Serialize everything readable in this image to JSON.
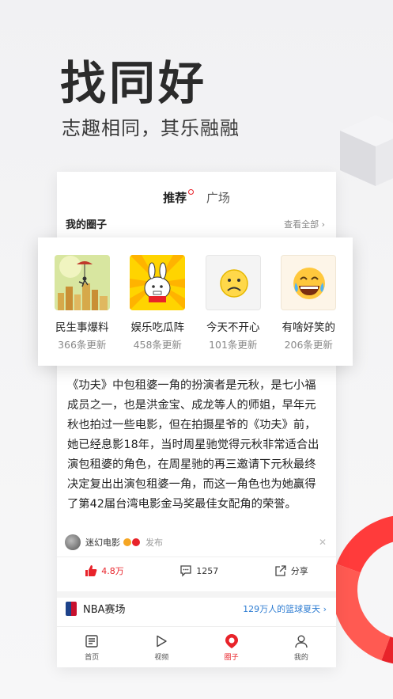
{
  "promo": {
    "headline": "找同好",
    "subhead": "志趣相同，其乐融融"
  },
  "tabs": [
    {
      "label": "推荐",
      "active": true
    },
    {
      "label": "广场",
      "active": false
    }
  ],
  "my_circles": {
    "title": "我的圈子",
    "see_all": "查看全部",
    "items": [
      {
        "name": "民生事爆料",
        "count": "366条更新"
      },
      {
        "name": "娱乐吃瓜阵",
        "count": "458条更新"
      },
      {
        "name": "今天不开心",
        "count": "101条更新"
      },
      {
        "name": "有啥好笑的",
        "count": "206条更新"
      }
    ]
  },
  "post": {
    "text": "《功夫》中包租婆一角的扮演者是元秋，是七小福成员之一，也是洪金宝、成龙等人的师姐，早年元秋也拍过一些电影，但在拍摄星爷的《功夫》前，她已经息影18年，当时周星驰觉得元秋非常适合出演包租婆的角色，在周星驰的再三邀请下元秋最终决定复出出演包租婆一角，而这一角色也为她赢得了第42届台湾电影金马奖最佳女配角的荣誉。",
    "author": "迷幻电影",
    "publish_label": "发布",
    "likes": "4.8万",
    "comments": "1257",
    "share_label": "分享"
  },
  "nba": {
    "name": "NBA赛场",
    "promo": "129万人的篮球夏天"
  },
  "bottom_nav": [
    {
      "label": "首页",
      "icon": "news-icon"
    },
    {
      "label": "视频",
      "icon": "play-icon"
    },
    {
      "label": "圈子",
      "icon": "circle-pin-icon",
      "active": true
    },
    {
      "label": "我的",
      "icon": "user-icon"
    }
  ],
  "colors": {
    "accent": "#e8232a",
    "link": "#2d7cd2"
  }
}
